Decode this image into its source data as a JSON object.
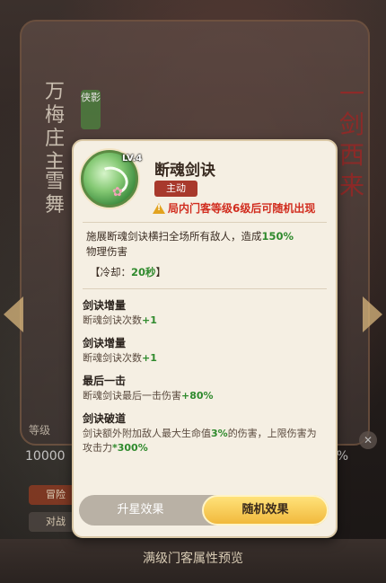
{
  "background": {
    "hero_name_top": "万梅庄主",
    "hero_name_bottom": "雪舞",
    "tag": "侠影",
    "calligraphy": "一剑西来",
    "level_label": "等级",
    "power_value": "10000",
    "pct_value": "%",
    "button_1": "冒险",
    "button_2": "对战",
    "close": "✕",
    "footer_text": "满级门客属性预览"
  },
  "skill": {
    "level": "LV.4",
    "name": "断魂剑诀",
    "type_badge": "主动",
    "warning": "局内门客等级6级后可随机出现",
    "desc_pre": "施展断魂剑诀横扫全场所有敌人，造成",
    "desc_pct": "150%",
    "desc_post": "物理伤害",
    "cooldown_pre": "【冷却：",
    "cooldown_val": "20秒",
    "cooldown_post": "】"
  },
  "effects": [
    {
      "title": "剑诀增量",
      "desc_pre": "断魂剑诀次数",
      "desc_val": "+1",
      "desc_post": ""
    },
    {
      "title": "剑诀增量",
      "desc_pre": "断魂剑诀次数",
      "desc_val": "+1",
      "desc_post": ""
    },
    {
      "title": "最后一击",
      "desc_pre": "断魂剑诀最后一击伤害",
      "desc_val": "+80%",
      "desc_post": ""
    },
    {
      "title": "剑诀破道",
      "desc_pre": "剑诀额外附加敌人最大生命值",
      "desc_val": "3%",
      "desc_post": "的伤害，上限伤害为攻击力",
      "desc_val2": "*300%"
    }
  ],
  "tabs": [
    {
      "label": "升星效果",
      "active": false
    },
    {
      "label": "随机效果",
      "active": true
    }
  ]
}
